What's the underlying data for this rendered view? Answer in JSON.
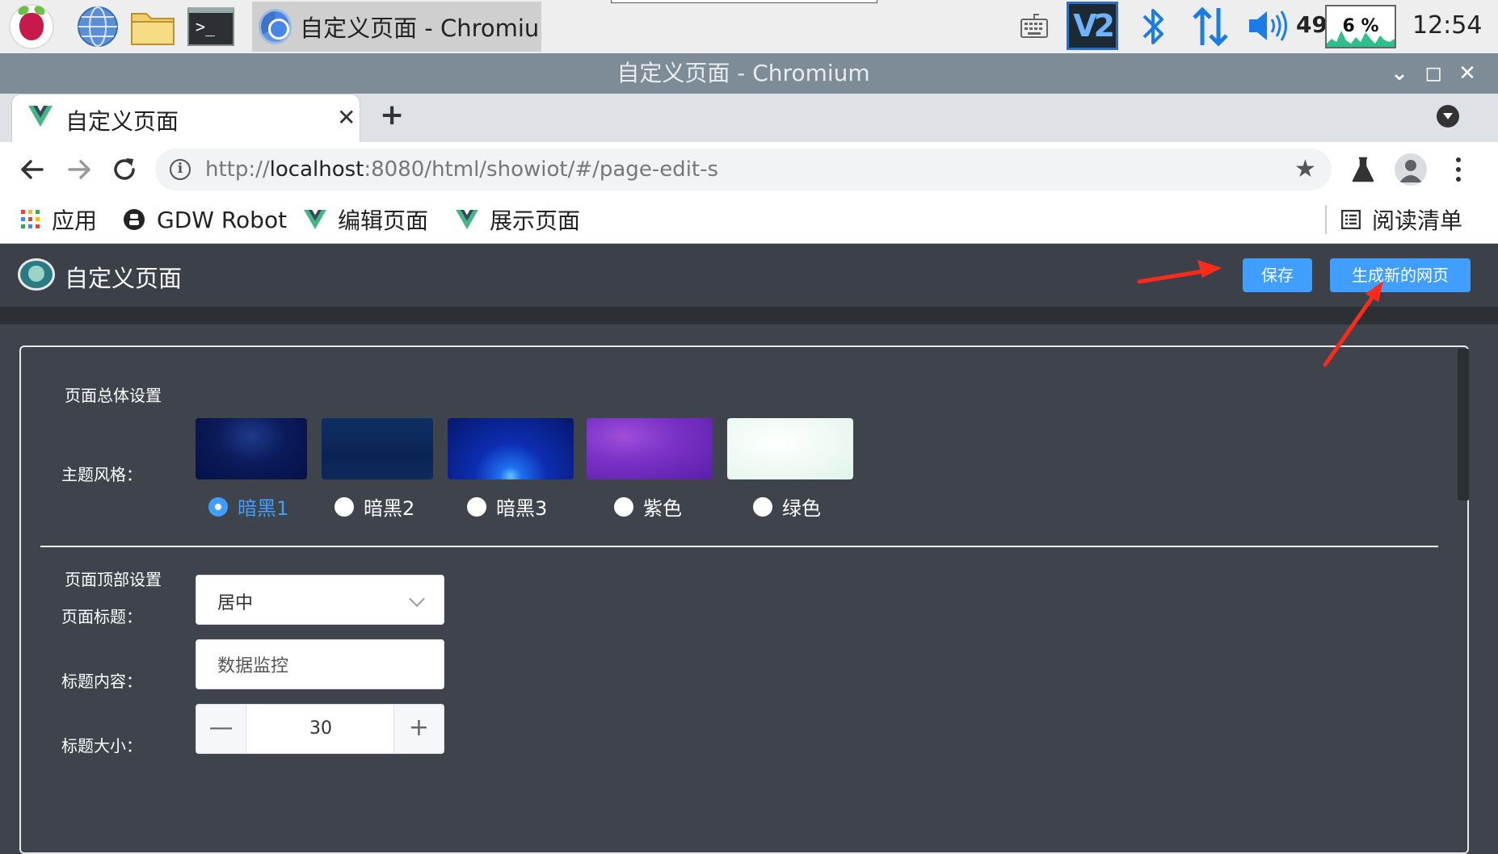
{
  "taskbar": {
    "task_chromium_label": "自定义页面 - Chromiu...",
    "volume_level": "49",
    "cpu_percent": "6 %",
    "clock": "12:54",
    "icons": [
      "raspberry-pi-menu-icon",
      "web-browser-icon",
      "file-manager-icon",
      "terminal-icon",
      "chromium-icon",
      "keyboard-icon",
      "vnc-icon",
      "bluetooth-icon",
      "network-icon",
      "volume-icon"
    ]
  },
  "window": {
    "title": "自定义页面 - Chromium",
    "controls": {
      "minimize": "⌄",
      "maximize": "◻",
      "close": "✕"
    }
  },
  "browser": {
    "active_tab_title": "自定义页面",
    "tab_close": "✕",
    "new_tab": "+",
    "url_prefix": "http://",
    "url_host": "localhost",
    "url_rest": ":8080/html/showiot/#/page-edit-s",
    "bookmarks": [
      {
        "label": "应用"
      },
      {
        "label": "GDW Robot"
      },
      {
        "label": "编辑页面"
      },
      {
        "label": "展示页面"
      }
    ],
    "reading_list": "阅读清单"
  },
  "app": {
    "title": "自定义页面",
    "save_label": "保存",
    "generate_label": "生成新的网页"
  },
  "settings": {
    "overall": {
      "title": "页面总体设置",
      "theme_label": "主题风格：",
      "themes": [
        {
          "label": "暗黑1",
          "checked": true
        },
        {
          "label": "暗黑2",
          "checked": false
        },
        {
          "label": "暗黑3",
          "checked": false
        },
        {
          "label": "紫色",
          "checked": false
        },
        {
          "label": "绿色",
          "checked": false
        }
      ]
    },
    "top": {
      "title": "页面顶部设置",
      "title_position_label": "页面标题：",
      "title_position_value": "居中",
      "title_content_label": "标题内容：",
      "title_content_value": "数据监控",
      "title_size_label": "标题大小：",
      "title_size_value": "30",
      "decrement": "—",
      "increment": "+"
    }
  },
  "colors": {
    "accent": "#409eff",
    "header_bg": "#3b4049",
    "page_bg": "#3e434c",
    "annotation": "#ff2a1a"
  }
}
